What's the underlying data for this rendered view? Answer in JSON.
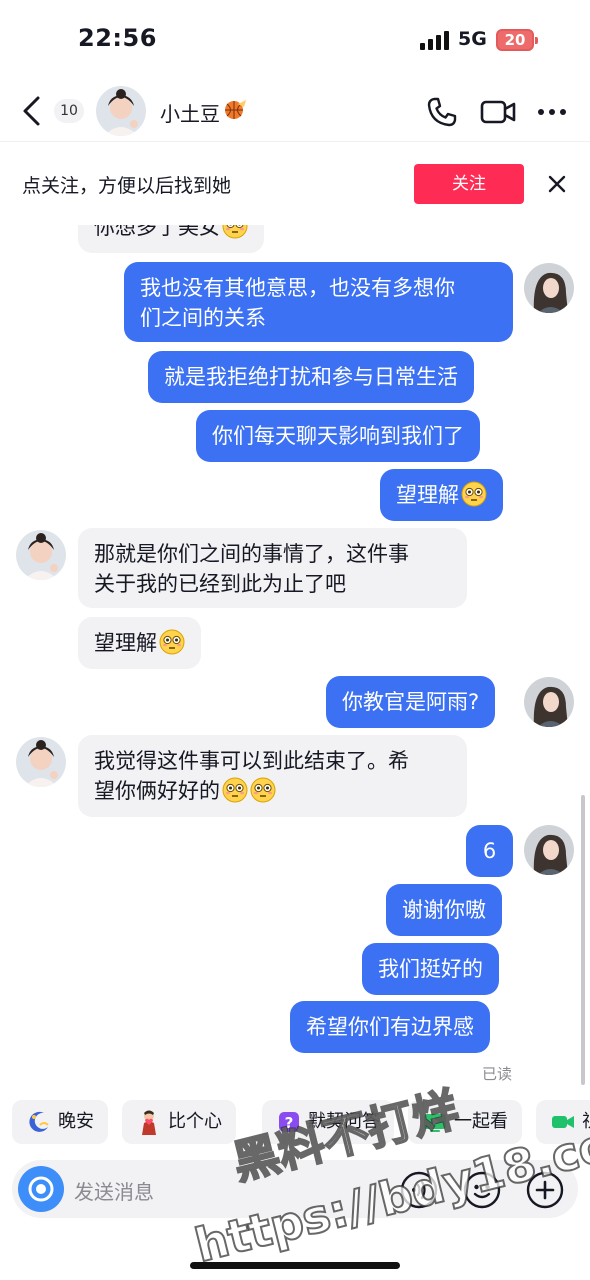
{
  "status_bar": {
    "time": "22:56",
    "network": "5G",
    "battery": "20"
  },
  "header": {
    "unread_count": "10",
    "contact_name": "小土豆"
  },
  "follow_banner": {
    "text": "点关注，方便以后找到她",
    "button": "关注"
  },
  "messages": [
    {
      "side": "in",
      "text": "你想多了美女",
      "emoji": true
    },
    {
      "side": "out",
      "lines": [
        "我也没有其他意思，也没有多想你",
        "们之间的关系"
      ]
    },
    {
      "side": "out",
      "text": "就是我拒绝打扰和参与日常生活"
    },
    {
      "side": "out",
      "text": "你们每天聊天影响到我们了"
    },
    {
      "side": "out",
      "text": "望理解",
      "emoji": true
    },
    {
      "side": "in",
      "lines": [
        "那就是你们之间的事情了，这件事",
        "关于我的已经到此为止了吧"
      ]
    },
    {
      "side": "in",
      "text": "望理解",
      "emoji": true
    },
    {
      "side": "out",
      "text": "你教官是阿雨?"
    },
    {
      "side": "in",
      "lines": [
        "我觉得这件事可以到此结束了。希",
        "望你俩好好的"
      ],
      "emoji_count": 2
    },
    {
      "side": "out",
      "text": "6"
    },
    {
      "side": "out",
      "text": "谢谢你嗷"
    },
    {
      "side": "out",
      "text": "我们挺好的"
    },
    {
      "side": "out",
      "text": "希望你们有边界感"
    }
  ],
  "read_status": "已读",
  "quick_actions": [
    {
      "label": "晚安",
      "icon": "moon-icon"
    },
    {
      "label": "比个心",
      "icon": "heart-gesture-icon"
    },
    {
      "label": "默契问答",
      "icon": "quiz-icon"
    },
    {
      "label": "一起看",
      "icon": "watch-together-icon"
    },
    {
      "label": "视",
      "icon": "video-chat-icon"
    }
  ],
  "input": {
    "placeholder": "发送消息"
  },
  "watermark": {
    "line1": "黑料不打烊",
    "line2": "https://bdy18.co"
  },
  "colors": {
    "outgoing_bubble": "#3b71f2",
    "incoming_bubble": "#f2f2f4",
    "follow_button": "#fe2c55",
    "camera_button": "#3d8ef8"
  }
}
